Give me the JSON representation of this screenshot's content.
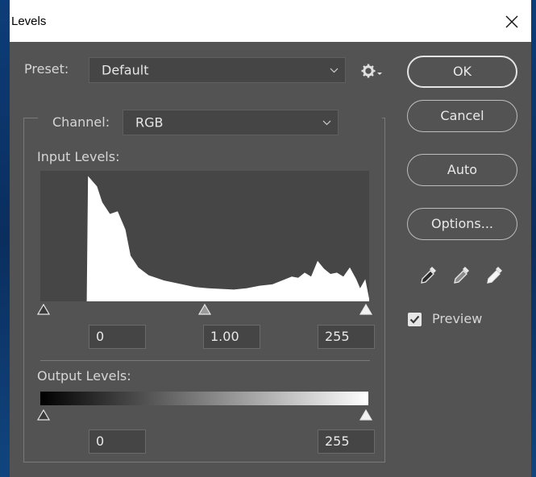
{
  "window": {
    "title": "Levels"
  },
  "preset": {
    "label": "Preset:",
    "value": "Default"
  },
  "channel": {
    "label": "Channel:",
    "value": "RGB"
  },
  "input_levels": {
    "label": "Input Levels:",
    "black": "0",
    "gamma": "1.00",
    "white": "255"
  },
  "output_levels": {
    "label": "Output Levels:",
    "black": "0",
    "white": "255"
  },
  "buttons": {
    "ok": "OK",
    "cancel": "Cancel",
    "auto": "Auto",
    "options": "Options..."
  },
  "preview": {
    "label": "Preview",
    "checked": true
  },
  "icons": {
    "close": "close-icon",
    "gear": "gear-icon",
    "dropdown": "chevron-down-icon",
    "black_point": "eyedropper-black-icon",
    "gray_point": "eyedropper-gray-icon",
    "white_point": "eyedropper-white-icon"
  },
  "colors": {
    "dialog_bg": "#535353",
    "field_bg": "#454545",
    "histogram_bg": "#464646",
    "histogram_fill": "#ffffff",
    "titlebar_bg": "#ffffff"
  },
  "chart_data": {
    "type": "area",
    "xlim": [
      0,
      255
    ],
    "ylim": [
      0,
      100
    ],
    "series": [
      {
        "x": [
          0,
          14,
          24,
          30,
          36,
          37,
          44,
          48,
          54,
          60,
          66,
          70,
          76,
          84,
          96,
          110,
          120,
          130,
          150,
          160,
          170,
          180,
          190,
          195,
          200,
          205,
          210,
          215,
          220,
          225,
          230,
          235,
          240,
          245,
          248,
          252,
          255
        ],
        "values": [
          0,
          0,
          0,
          0,
          0,
          96,
          88,
          76,
          67,
          69,
          55,
          35,
          26,
          20,
          16,
          13,
          11,
          10,
          9,
          10,
          12,
          13,
          17,
          19,
          18,
          22,
          19,
          31,
          25,
          21,
          22,
          19,
          26,
          17,
          10,
          17,
          2
        ]
      }
    ]
  }
}
